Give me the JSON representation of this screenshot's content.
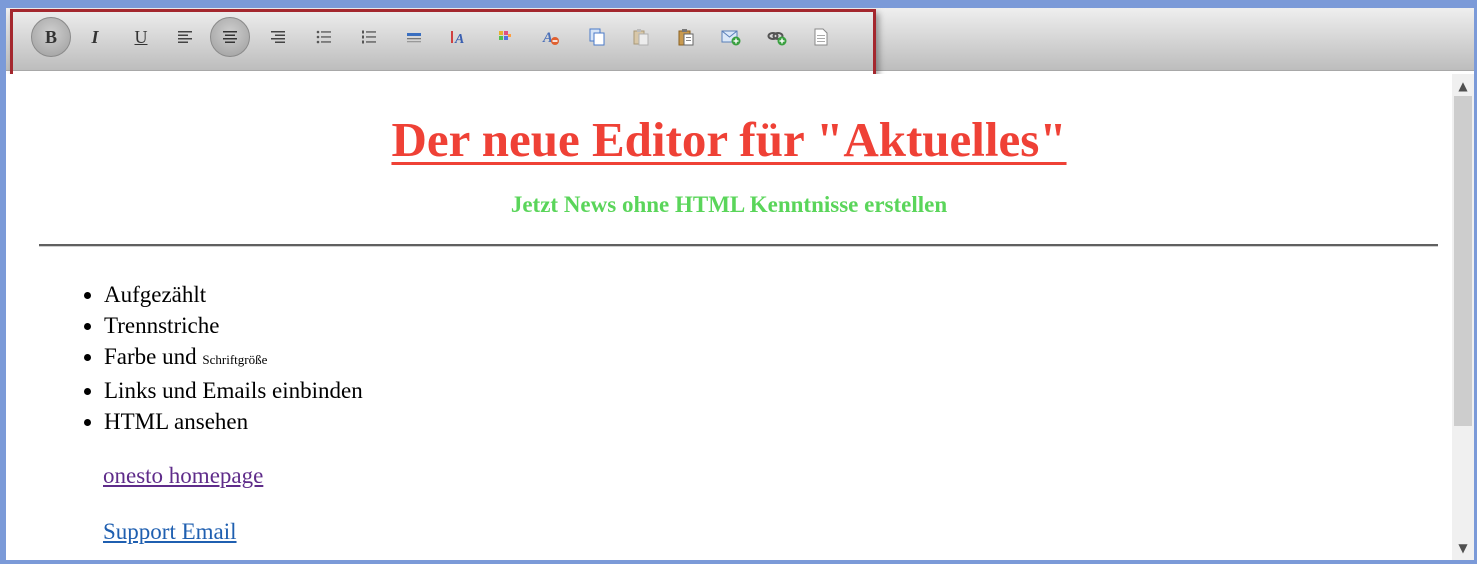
{
  "toolbar": {
    "buttons": [
      {
        "name": "bold-button",
        "icon": "bold-icon",
        "glyph": "B",
        "active": true
      },
      {
        "name": "italic-button",
        "icon": "italic-icon",
        "glyph": "I"
      },
      {
        "name": "underline-button",
        "icon": "underline-icon",
        "glyph": "U"
      },
      {
        "name": "align-left-button",
        "icon": "align-left-icon"
      },
      {
        "name": "align-center-button",
        "icon": "align-center-icon",
        "active": true
      },
      {
        "name": "align-right-button",
        "icon": "align-right-icon"
      },
      {
        "name": "bulleted-list-button",
        "icon": "bulleted-list-icon"
      },
      {
        "name": "numbered-list-button",
        "icon": "numbered-list-icon"
      },
      {
        "name": "horizontal-rule-button",
        "icon": "horizontal-rule-icon"
      },
      {
        "name": "font-size-button",
        "icon": "font-size-icon"
      },
      {
        "name": "font-color-button",
        "icon": "color-palette-icon"
      },
      {
        "name": "remove-format-button",
        "icon": "remove-format-icon"
      },
      {
        "name": "copy-button",
        "icon": "copy-icon"
      },
      {
        "name": "cut-button",
        "icon": "cut-icon"
      },
      {
        "name": "paste-button",
        "icon": "paste-icon"
      },
      {
        "name": "insert-email-button",
        "icon": "email-add-icon"
      },
      {
        "name": "insert-link-button",
        "icon": "link-add-icon"
      },
      {
        "name": "view-html-button",
        "icon": "document-icon"
      }
    ]
  },
  "content": {
    "title": "Der neue Editor für \"Aktuelles\"",
    "subtitle": "Jetzt News ohne HTML Kenntnisse erstellen",
    "list_items": {
      "item1": "Aufgezählt",
      "item2": "Trennstriche",
      "item3_main": "Farbe und",
      "item3_small": "Schriftgröße",
      "item4": "Links und Emails einbinden",
      "item5": "HTML ansehen"
    },
    "link_homepage": "onesto homepage",
    "link_email": "Support Email"
  },
  "colors": {
    "title": "#ef4136",
    "subtitle": "#5ad55a",
    "highlight_border": "#a4272e",
    "frame": "#7b9ad8"
  }
}
